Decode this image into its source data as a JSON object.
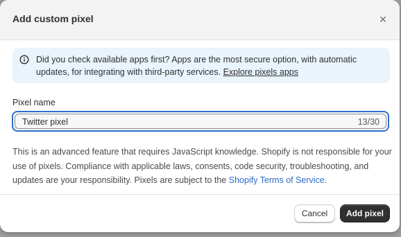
{
  "dialog": {
    "title": "Add custom pixel",
    "close_icon": "close-icon",
    "close_glyph": "×"
  },
  "banner": {
    "icon": "info-icon",
    "text": "Did you check available apps first? Apps are the most secure option, with automatic updates, for integrating with third-party services. ",
    "link_label": "Explore pixels apps"
  },
  "pixel_name": {
    "label": "Pixel name",
    "value": "Twitter pixel",
    "char_count": "13/30"
  },
  "description": {
    "text": "This is an advanced feature that requires JavaScript knowledge. Shopify is not responsible for your use of pixels. Compliance with applicable laws, consents, code security, troubleshooting, and updates are your responsibility. Pixels are subject to the ",
    "link_label": "Shopify Terms of Service",
    "suffix": "."
  },
  "footer": {
    "cancel_label": "Cancel",
    "add_label": "Add pixel"
  },
  "colors": {
    "banner_bg": "#e9f4fc",
    "focus_ring": "#2c6ecb",
    "link": "#2c6ecb",
    "primary_button": "#303030"
  }
}
